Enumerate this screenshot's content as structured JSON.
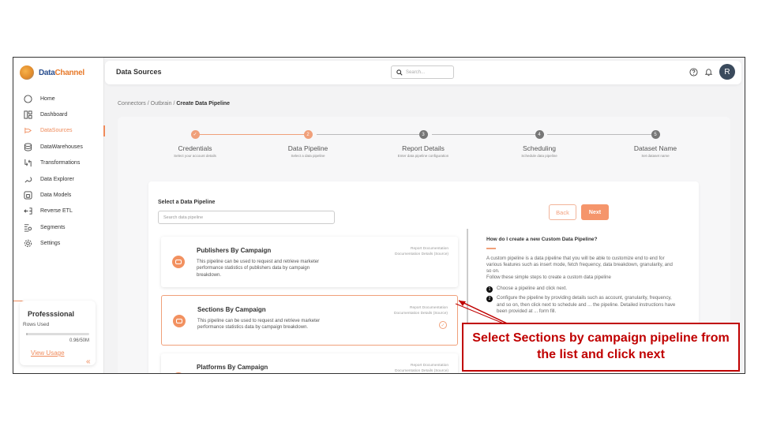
{
  "sidebar": {
    "logo": {
      "part1": "Data",
      "part2": "Channel"
    },
    "items": [
      {
        "label": "Home",
        "icon": "home-icon"
      },
      {
        "label": "Dashboard",
        "icon": "dashboard-icon"
      },
      {
        "label": "DataSources",
        "icon": "datasources-icon",
        "active": true
      },
      {
        "label": "DataWarehouses",
        "icon": "database-icon"
      },
      {
        "label": "Transformations",
        "icon": "transform-icon"
      },
      {
        "label": "Data Explorer",
        "icon": "explorer-icon"
      },
      {
        "label": "Data Models",
        "icon": "models-icon"
      },
      {
        "label": "Reverse ETL",
        "icon": "reverse-etl-icon"
      },
      {
        "label": "Segments",
        "icon": "segments-icon"
      },
      {
        "label": "Settings",
        "icon": "gear-icon"
      }
    ],
    "plan": {
      "title": "Professsional",
      "rows_label": "Rows Used",
      "usage": "0.96/50M",
      "usage_fraction": 0.02,
      "link": "View Usage"
    },
    "collapse_glyph": "«"
  },
  "header": {
    "title": "Data Sources",
    "search_placeholder": "Search...",
    "avatar_initial": "R"
  },
  "breadcrumb": {
    "items": [
      "Connectors",
      "Outbrain"
    ],
    "separator": "/",
    "current": "Create Data Pipeline"
  },
  "stepper": [
    {
      "title": "Credentials",
      "subtitle": "Select your account details",
      "state": "done",
      "marker": "✓"
    },
    {
      "title": "Data Pipeline",
      "subtitle": "Select a data pipeline",
      "state": "current",
      "marker": "2"
    },
    {
      "title": "Report Details",
      "subtitle": "Enter data pipeline configuration",
      "state": "todo",
      "marker": "3"
    },
    {
      "title": "Scheduling",
      "subtitle": "Schedule data pipeline",
      "state": "todo",
      "marker": "4"
    },
    {
      "title": "Dataset Name",
      "subtitle": "Set dataset name",
      "state": "todo",
      "marker": "5"
    }
  ],
  "content": {
    "select_label": "Select a Data Pipeline",
    "search_placeholder": "Search data pipeline",
    "back_label": "Back",
    "next_label": "Next",
    "pipelines": [
      {
        "title": "Publishers By Campaign",
        "description": "This pipeline can be used to request and retrieve marketer performance statistics of publishers data by campaign breakdown.",
        "doc_line1": "Report Documentation",
        "doc_line2": "Documentation Details (Source)",
        "selected": false
      },
      {
        "title": "Sections By Campaign",
        "description": "This pipeline can be used to request and retrieve marketer performance statistics data by campaign breakdown.",
        "doc_line1": "Report Documentation",
        "doc_line2": "Documentation Details (Source)",
        "selected": true
      },
      {
        "title": "Platforms By Campaign",
        "description": "",
        "doc_line1": "Report Documentation",
        "doc_line2": "Documentation Details (Source)",
        "selected": false
      }
    ],
    "help": {
      "question": "How do I create a new Custom Data Pipeline?",
      "paragraph": "A custom pipeline is a data pipeline that you will be able to customize end to end for various features such as insert mode, fetch frequency, data breakdown, granularity, and so on.",
      "intro": "Follow these simple steps to create a custom data pipeline",
      "steps": [
        "Choose a pipeline and click next.",
        "Configure the pipeline by providing details such as account, granularity, frequency, and so on, then click next to schedule and ... the pipeline. Detailed instructions have been provided at ... form fill."
      ]
    }
  },
  "annotation": {
    "text": "Select Sections by campaign pipeline from the list and click next",
    "color": "#c00000"
  },
  "colors": {
    "accent": "#ef8a5a",
    "brand_blue": "#2a4f8f",
    "avatar": "#3a4a5c"
  }
}
